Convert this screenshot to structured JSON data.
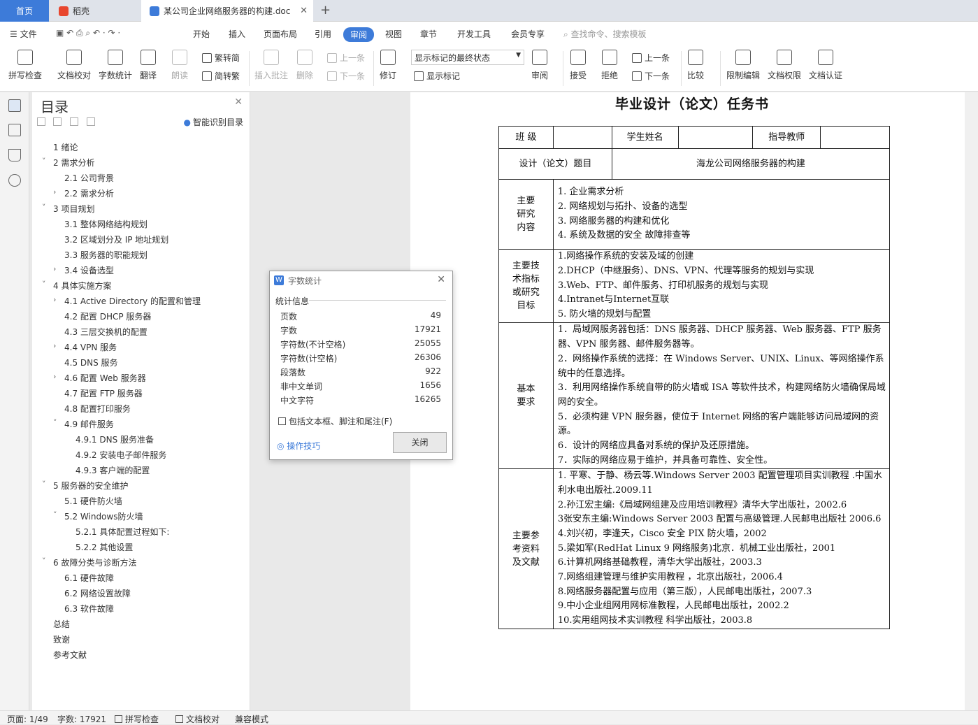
{
  "tabs": {
    "home": "首页",
    "doke": "稻壳",
    "doc": "某公司企业网络服务器的构建.doc"
  },
  "menu": [
    "文件",
    "开始",
    "插入",
    "页面布局",
    "引用",
    "审阅",
    "视图",
    "章节",
    "开发工具",
    "会员专享"
  ],
  "search_placeholder": "查找命令、搜索模板",
  "ribbon": {
    "spell": "拼写检查",
    "proof": "文档校对",
    "wordcount": "字数统计",
    "translate": "翻译",
    "read": "朗读",
    "trad": "繁转简",
    "simp": "简转繁",
    "insert_comment": "插入批注",
    "delete": "删除",
    "prev": "上一条",
    "next": "下一条",
    "revise": "修订",
    "markup_state": "显示标记的最终状态",
    "show_markup": "显示标记",
    "review": "审阅",
    "accept": "接受",
    "reject": "拒绝",
    "prev2": "上一条",
    "next2": "下一条",
    "compare": "比较",
    "restrict": "限制编辑",
    "permission": "文档权限",
    "certify": "文档认证"
  },
  "toc": {
    "title": "目录",
    "smart": "智能识别目录",
    "items": [
      "1 绪论",
      "2 需求分析",
      "2.1 公司背景",
      "2.2 需求分析",
      "3 项目规划",
      "3.1 整体网络结构规划",
      "3.2 区域划分及 IP 地址规划",
      "3.3 服务器的职能规划",
      "3.4 设备选型",
      "4 具体实施方案",
      "4.1 Active Directory 的配置和管理",
      "4.2 配置 DHCP 服务器",
      "4.3 三层交换机的配置",
      "4.4 VPN 服务",
      "4.5 DNS 服务",
      "4.6 配置 Web 服务器",
      "4.7 配置 FTP 服务器",
      "4.8 配置打印服务",
      "4.9 邮件服务",
      "4.9.1 DNS 服务准备",
      "4.9.2 安装电子邮件服务",
      "4.9.3 客户端的配置",
      "5 服务器的安全维护",
      "5.1 硬件防火墙",
      "5.2 Windows防火墙",
      "5.2.1 具体配置过程如下:",
      "5.2.2 其他设置",
      "6 故障分类与诊断方法",
      "6.1 硬件故障",
      "6.2 网络设置故障",
      "6.3 软件故障",
      "总结",
      "致谢",
      "参考文献"
    ]
  },
  "doc": {
    "title": "毕业设计（论文）任务书",
    "class_label": "班 级",
    "student_label": "学生姓名",
    "teacher_label": "指导教师",
    "topic_label": "设计（论文）题目",
    "topic": "海龙公司网络服务器的构建",
    "content_label": "主要\n研究\n内容",
    "content": [
      "1. 企业需求分析",
      "2.  网络规划与拓扑、设备的选型",
      "3.  网络服务器的构建和优化",
      "4.  系统及数据的安全  故障排查等"
    ],
    "tech_label": "主要技\n术指标\n或研究\n目标",
    "tech": [
      "1.网络操作系统的安装及域的创建",
      "2.DHCP（中继服务）、DNS、VPN、代理等服务的规划与实现",
      "3.Web、FTP、邮件服务、打印机服务的规划与实现",
      "4.Intranet与Internet互联",
      "5. 防火墙的规划与配置"
    ],
    "req_label": "基本\n要求",
    "req": [
      "1．局域网服务器包括：DNS 服务器、DHCP 服务器、Web 服务器、FTP 服务器、VPN 服务器、邮件服务器等。",
      "2．网络操作系统的选择：在 Windows   Server、UNIX、Linux、等网络操作系统中的任意选择。",
      "3．利用网络操作系统自带的防火墙或 ISA 等软件技术，构建网络防火墙确保局域网的安全。",
      "5．必须构建 VPN 服务器，使位于 Internet 网络的客户端能够访问局域网的资源。",
      "6．设计的网络应具备对系统的保护及还原措施。",
      "7．实际的网络应易于维护，并具备可靠性、安全性。"
    ],
    "ref_label": "主要参\n考资料\n及文献",
    "refs": [
      "1. 平寒、于静、杨云等.Windows Server 2003  配置管理项目实训教程  .中国水利水电出版社.2009.11",
      "2.孙江宏主编:《局域网组建及应用培训教程》清华大学出版社，2002.6",
      "3张安东主编:Windows Server 2003 配置与高级管理.人民邮电出版社 2006.6",
      "4.刘兴初，李逢天，Cisco 安全 PIX 防火墙，2002",
      "5.梁如军(RedHat Linux 9 网络服务)北京．机械工业出版社，2001",
      "6.计算机网络基础教程，清华大学出版社，2003.3",
      "7.网络组建管理与维护实用教程 ，北京出版社，2006.4",
      "8.网络服务器配置与应用（第三版），人民邮电出版社，2007.3",
      "9.中小企业组网用网标准教程，人民邮电出版社，2002.2",
      "10.实用组网技术实训教程  科学出版社，2003.8"
    ]
  },
  "dialog": {
    "title": "字数统计",
    "section": "统计信息",
    "rows": [
      [
        "页数",
        "49"
      ],
      [
        "字数",
        "17921"
      ],
      [
        "字符数(不计空格)",
        "25055"
      ],
      [
        "字符数(计空格)",
        "26306"
      ],
      [
        "段落数",
        "922"
      ],
      [
        "非中文单词",
        "1656"
      ],
      [
        "中文字符",
        "16265"
      ]
    ],
    "include": "包括文本框、脚注和尾注(F)",
    "tips": "操作技巧",
    "close": "关闭"
  },
  "status": {
    "page": "页面: 1/49",
    "words": "字数: 17921",
    "spell": "拼写检查",
    "proof": "文档校对",
    "compat": "兼容模式"
  }
}
